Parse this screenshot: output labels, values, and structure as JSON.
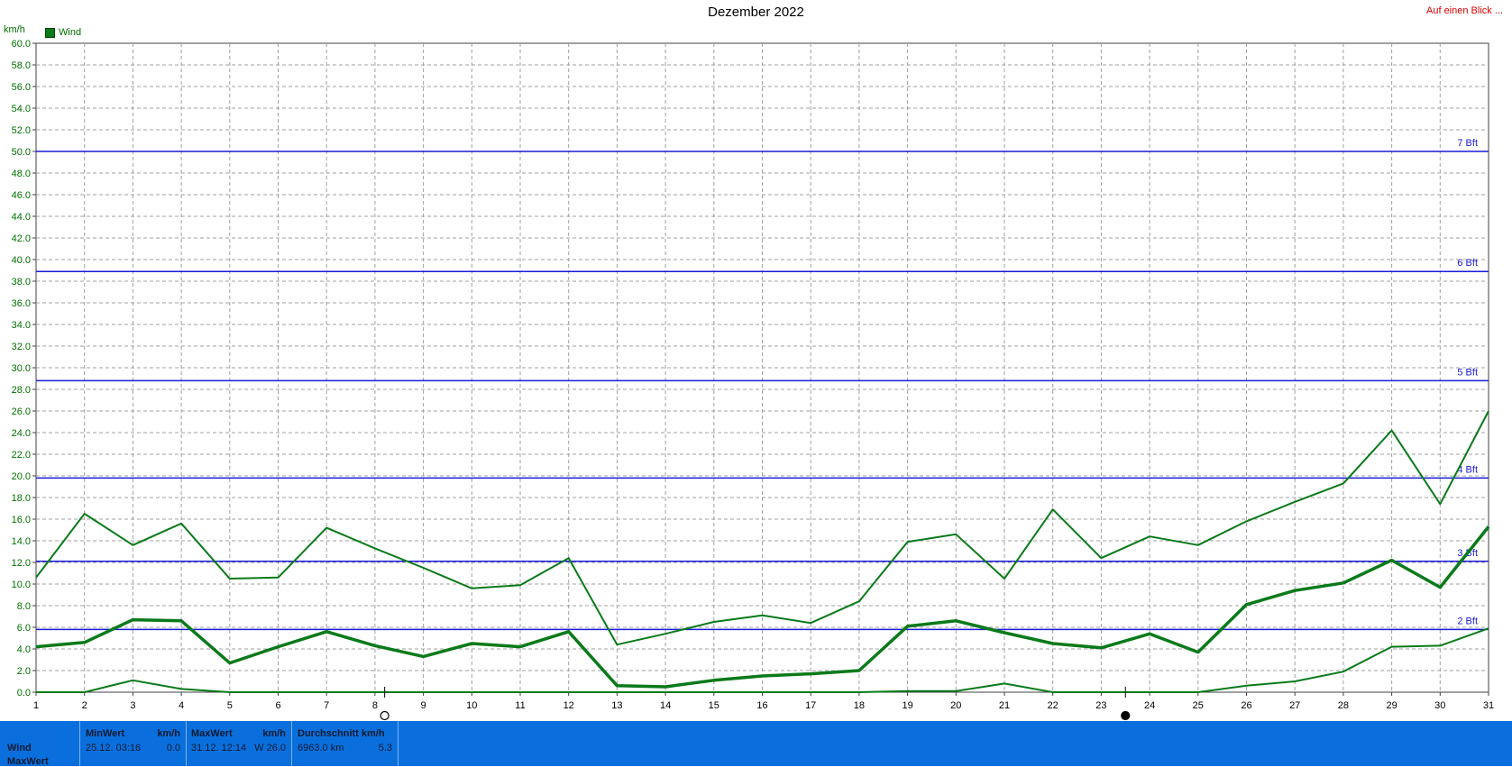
{
  "header": {
    "title": "Dezember 2022",
    "link": "Auf einen Blick ...",
    "unit": "km/h",
    "legend": "Wind"
  },
  "chart_data": {
    "type": "line",
    "title": "Dezember 2022",
    "ylabel": "km/h",
    "xlabel": "",
    "ylim": [
      0,
      60
    ],
    "yticks": [
      "0.0",
      "2.0",
      "4.0",
      "6.0",
      "8.0",
      "10.0",
      "12.0",
      "14.0",
      "16.0",
      "18.0",
      "20.0",
      "22.0",
      "24.0",
      "26.0",
      "28.0",
      "30.0",
      "32.0",
      "34.0",
      "36.0",
      "38.0",
      "40.0",
      "42.0",
      "44.0",
      "46.0",
      "48.0",
      "50.0",
      "52.0",
      "54.0",
      "56.0",
      "58.0",
      "60.0"
    ],
    "x": [
      1,
      2,
      3,
      4,
      5,
      6,
      7,
      8,
      9,
      10,
      11,
      12,
      13,
      14,
      15,
      16,
      17,
      18,
      19,
      20,
      21,
      22,
      23,
      24,
      25,
      26,
      27,
      28,
      29,
      30,
      31
    ],
    "grid": true,
    "legend_position": "top-left",
    "series": [
      {
        "name": "Wind",
        "role": "max",
        "color": "#0a7a1a",
        "width": 2,
        "values": [
          10.6,
          16.5,
          13.6,
          15.6,
          10.5,
          10.6,
          15.2,
          13.3,
          11.5,
          9.6,
          9.9,
          12.4,
          4.4,
          5.4,
          6.5,
          7.1,
          6.4,
          8.4,
          13.9,
          14.6,
          10.5,
          16.9,
          12.4,
          14.4,
          13.6,
          15.8,
          17.6,
          19.3,
          24.2,
          17.4,
          26.0
        ]
      },
      {
        "name": "Wind",
        "role": "avg",
        "color": "#0a7a1a",
        "width": 3.5,
        "values": [
          4.2,
          4.6,
          6.7,
          6.6,
          2.7,
          4.2,
          5.6,
          4.3,
          3.3,
          4.5,
          4.2,
          5.6,
          0.6,
          0.5,
          1.1,
          1.5,
          1.7,
          2.0,
          6.1,
          6.6,
          5.5,
          4.5,
          4.1,
          5.4,
          3.7,
          8.1,
          9.4,
          10.1,
          12.2,
          9.7,
          15.3
        ]
      },
      {
        "name": "Wind",
        "role": "min",
        "color": "#0a7a1a",
        "width": 2,
        "values": [
          0.0,
          0.0,
          1.1,
          0.3,
          0.0,
          0.0,
          0.0,
          0.0,
          0.0,
          0.0,
          0.0,
          0.0,
          0.0,
          0.0,
          0.0,
          0.0,
          0.0,
          0.0,
          0.1,
          0.1,
          0.8,
          0.0,
          0.0,
          0.0,
          0.0,
          0.6,
          1.0,
          1.9,
          4.2,
          4.3,
          5.9
        ]
      }
    ],
    "bft_lines": [
      {
        "label": "2 Bft",
        "value": 5.8
      },
      {
        "label": "3 Bft",
        "value": 12.1
      },
      {
        "label": "4 Bft",
        "value": 19.8
      },
      {
        "label": "5 Bft",
        "value": 28.8
      },
      {
        "label": "6 Bft",
        "value": 38.9
      },
      {
        "label": "7 Bft",
        "value": 50.0
      }
    ],
    "moon_markers": [
      {
        "day": 8.2,
        "phase": "full"
      },
      {
        "day": 23.5,
        "phase": "new"
      }
    ],
    "colors": {
      "grid": "#a0a0a0",
      "bft": "#1a1ad8",
      "series": "#0a7a1a",
      "axis": "#404040"
    }
  },
  "stats": {
    "row_labels": [
      "Wind",
      "MaxWert"
    ],
    "min": {
      "header": "MinWert",
      "unit": "km/h",
      "time": "25.12.  03:16",
      "value": "0.0"
    },
    "max": {
      "header": "MaxWert",
      "unit": "km/h",
      "time": "31.12.  12:14",
      "value": "W 26.0"
    },
    "avg": {
      "header": "Durchschnitt km/h",
      "unit": "",
      "time": "6963.0 km",
      "value": "5.3"
    }
  }
}
